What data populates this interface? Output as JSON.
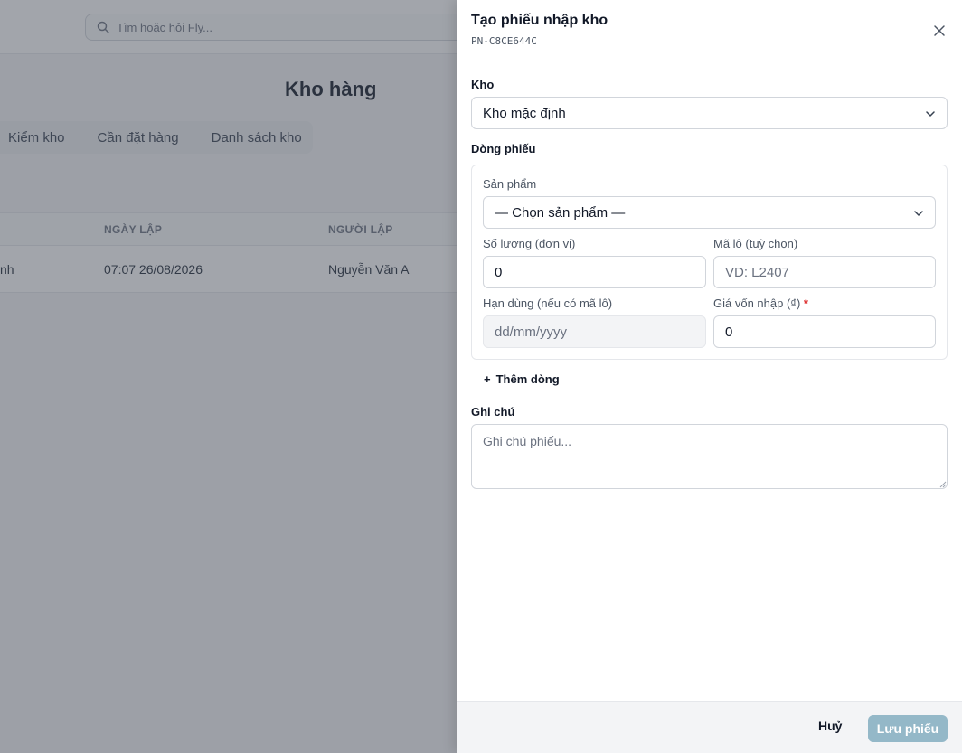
{
  "background": {
    "search_placeholder": "Tìm hoặc hỏi Fly...",
    "page_title": "Kho hàng",
    "tabs": [
      "Kiểm kho",
      "Cần đặt hàng",
      "Danh sách kho"
    ],
    "table": {
      "headers": {
        "date": "NGÀY LẬP",
        "creator": "NGƯỜI LẬP"
      },
      "rows": [
        {
          "name_partial": "nh",
          "date": "07:07 26/08/2026",
          "creator": "Nguyễn Văn A"
        }
      ]
    }
  },
  "drawer": {
    "title": "Tạo phiếu nhập kho",
    "code": "PN-C8CE644C",
    "close_icon": "close-icon",
    "warehouse": {
      "label": "Kho",
      "value": "Kho mặc định"
    },
    "lines_label": "Dòng phiếu",
    "line": {
      "product_label": "Sản phẩm",
      "product_value": "— Chọn sản phẩm —",
      "qty_label": "Số lượng (đơn vị)",
      "qty_value": "0",
      "lot_label": "Mã lô (tuỳ chọn)",
      "lot_placeholder": "VD: L2407",
      "expiry_label": "Hạn dùng (nếu có mã lô)",
      "expiry_placeholder": "dd/mm/yyyy",
      "cost_label": "Giá vốn nhập (₫)",
      "cost_required": "*",
      "cost_value": "0"
    },
    "add_line": {
      "icon": "+",
      "label": "Thêm dòng"
    },
    "note": {
      "label": "Ghi chú",
      "placeholder": "Ghi chú phiếu..."
    },
    "footer": {
      "cancel": "Huỷ",
      "save": "Lưu phiếu"
    }
  },
  "colors": {
    "save_button": "#94b8c8",
    "overlay": "#464c58",
    "required": "#dc2626"
  }
}
